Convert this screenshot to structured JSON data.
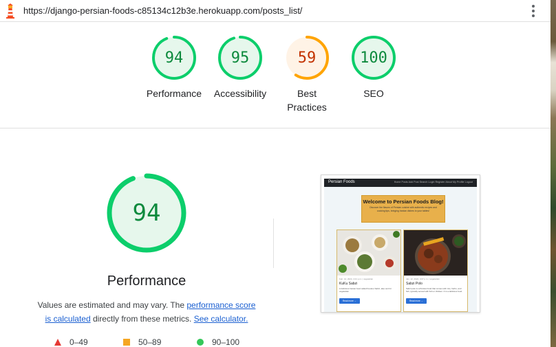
{
  "topbar": {
    "url": "https://django-persian-foods-c85134c12b3e.herokuapp.com/posts_list/"
  },
  "summary": [
    {
      "score": "94",
      "label": "Performance",
      "fraction": 0.94,
      "color": "#0cce6b",
      "text_color": "#0d8a3d"
    },
    {
      "score": "95",
      "label": "Accessibility",
      "fraction": 0.95,
      "color": "#0cce6b",
      "text_color": "#0d8a3d"
    },
    {
      "score": "59",
      "label_line1": "Best",
      "label_line2": "Practices",
      "fraction": 0.59,
      "color": "#ffa400",
      "text_color": "#c33300"
    },
    {
      "score": "100",
      "label": "SEO",
      "fraction": 1.0,
      "color": "#0cce6b",
      "text_color": "#0d8a3d"
    }
  ],
  "detail": {
    "score": "94",
    "fraction": 0.94,
    "title": "Performance",
    "desc_prefix": "Values are estimated and may vary. The ",
    "link_score": "performance score",
    "link_calc": "is calculated",
    "desc_middle": " directly from these metrics. ",
    "link_see": "See calculator."
  },
  "legend": [
    {
      "range": "0–49",
      "icon": "triangle-icon",
      "color": "#e53935"
    },
    {
      "range": "50–89",
      "icon": "square-icon",
      "color": "#f5a623"
    },
    {
      "range": "90–100",
      "icon": "circle-icon",
      "color": "#34c759"
    }
  ],
  "thumbnail": {
    "brand": "Persian Foods",
    "nav_links": "Home  Posts  Add Post  Search  Login  Register  About  My Profile  Logout",
    "welcome_title": "Welcome to Persian Foods Blog!",
    "welcome_text": "Discover the flavors of Persian cuisine with authentic recipes and cooking tips, bringing Iranian dishes to your tables!",
    "cards": [
      {
        "meta": "Feb. 14, 2024, 4:21 p.m. | vegetarian",
        "title": "KuKu Sabzi",
        "excerpt": "A delicious Iranian food called Kookoo Sabzi, also suit for vegetarian",
        "button": "Read more →"
      },
      {
        "meta": "Jan. 12, 2024, 4:07 p.m. | vegetarian",
        "title": "Sabzi Polo",
        "excerpt": "Sabzi polo is a Persian food that comes with rice, herbs, and fish, typically served with fish or chicken. It is a delicious food.",
        "button": "Read more →"
      }
    ]
  }
}
